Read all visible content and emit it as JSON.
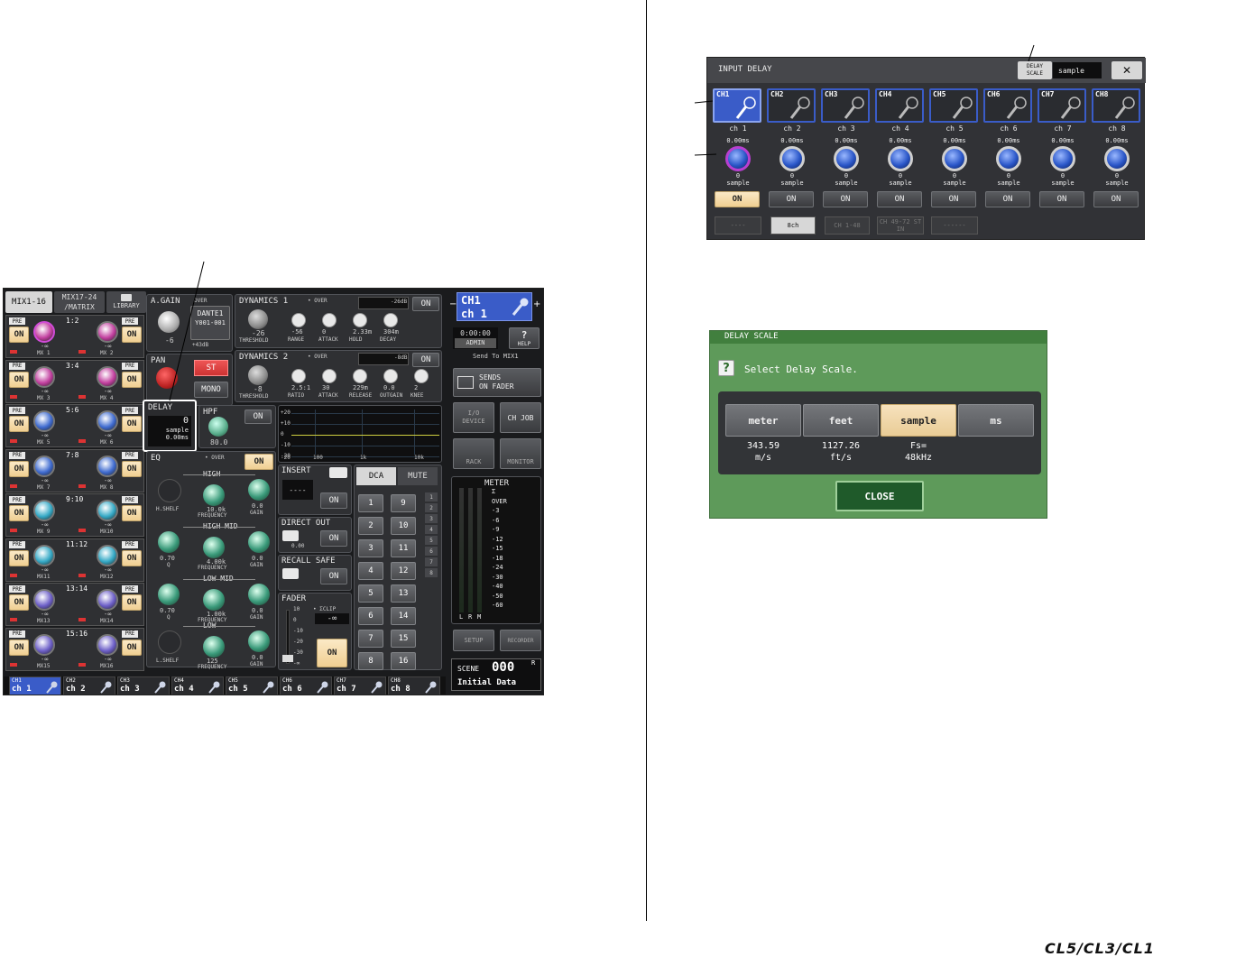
{
  "console": {
    "tabs": {
      "mix1_16": "MIX1-16",
      "mix17_24_l1": "MIX17-24",
      "mix17_24_l2": "/MATRIX",
      "library": "LIBRARY"
    },
    "mix_rows": [
      {
        "pair": "1:2",
        "left": "MX 1",
        "right": "MX 2"
      },
      {
        "pair": "3:4",
        "left": "MX 3",
        "right": "MX 4"
      },
      {
        "pair": "5:6",
        "left": "MX 5",
        "right": "MX 6"
      },
      {
        "pair": "7:8",
        "left": "MX 7",
        "right": "MX 8"
      },
      {
        "pair": "9:10",
        "left": "MX 9",
        "right": "MX10"
      },
      {
        "pair": "11:12",
        "left": "MX11",
        "right": "MX12"
      },
      {
        "pair": "13:14",
        "left": "MX13",
        "right": "MX14"
      },
      {
        "pair": "15:16",
        "left": "MX15",
        "right": "MX16"
      }
    ],
    "mix_on": "ON",
    "mix_pre": "PRE",
    "mix_level": "-∞",
    "again": {
      "label": "A.GAIN",
      "value": "-6"
    },
    "over": "OVER",
    "dante": {
      "name": "DANTE1",
      "port": "Y001-001",
      "gain": "+43dB"
    },
    "pan": {
      "label": "PAN",
      "st": "ST",
      "mono": "MONO"
    },
    "dyn1": {
      "label": "DYNAMICS 1",
      "over": "• OVER",
      "db": "-26dB",
      "on": "ON",
      "threshold": "-26",
      "range": "-56",
      "attack": "0",
      "hold": "2.33m",
      "decay": "304m",
      "threshold_l": "THRESHOLD",
      "range_l": "RANGE",
      "attack_l": "ATTACK",
      "hold_l": "HOLD",
      "decay_l": "DECAY"
    },
    "dyn2": {
      "label": "DYNAMICS 2",
      "over": "• OVER",
      "db": "-8dB",
      "on": "ON",
      "threshold": "-8",
      "ratio": "2.5:1",
      "attack": "30",
      "release": "229m",
      "outgain": "0.0",
      "knee": "2",
      "threshold_l": "THRESHOLD",
      "ratio_l": "RATIO",
      "attack_l": "ATTACK",
      "release_l": "RELEASE",
      "outgain_l": "OUTGAIN",
      "knee_l": "KNEE"
    },
    "delay": {
      "label": "DELAY",
      "value": "0",
      "unit": "sample",
      "ms": "0.00ms"
    },
    "hpf": {
      "label": "HPF",
      "on": "ON",
      "freq": "80.0"
    },
    "eq": {
      "label": "EQ",
      "over": "• OVER",
      "on": "ON",
      "high": "HIGH",
      "high_mid": "HIGH MID",
      "low_mid": "LOW MID",
      "low": "LOW",
      "h_shelf": "H.SHELF",
      "l_shelf": "L.SHELF",
      "high_freq": "10.0k",
      "high_gain": "0.0",
      "hmid_q": "0.70",
      "hmid_freq": "4.00k",
      "hmid_gain": "0.0",
      "lmid_q": "0.70",
      "lmid_freq": "1.00k",
      "lmid_gain": "0.0",
      "low_freq": "125",
      "low_gain": "0.0",
      "freq_l": "FREQUENCY",
      "gain_l": "GAIN",
      "q_l": "Q"
    },
    "graph": {
      "y": [
        "+20",
        "+10",
        "0",
        "-10",
        "-20"
      ],
      "x": [
        "-20",
        "100",
        "1k",
        "10k"
      ]
    },
    "insert": {
      "label": "INSERT",
      "value": "----",
      "on": "ON"
    },
    "direct_out": {
      "label": "DIRECT OUT",
      "value": "0.00",
      "on": "ON"
    },
    "recall_safe": {
      "label": "RECALL SAFE",
      "on": "ON"
    },
    "fader": {
      "label": "FADER",
      "clip": "• ΣCLIP",
      "value": "-∞",
      "on": "ON",
      "scale": [
        "10",
        "0",
        "-10",
        "-20",
        "-30",
        "-∞"
      ]
    },
    "dca": {
      "tab": "DCA",
      "mute": "MUTE",
      "buttons": [
        "1",
        "9",
        "2",
        "10",
        "3",
        "11",
        "4",
        "12",
        "5",
        "13",
        "6",
        "14",
        "7",
        "15",
        "8",
        "16"
      ],
      "side": [
        "1",
        "2",
        "3",
        "4",
        "5",
        "6",
        "7",
        "8"
      ]
    },
    "right": {
      "ch_id": "CH1",
      "ch_name": "ch 1",
      "time": "0:00:00",
      "user": "ADMIN",
      "help": "HELP",
      "send_to": "Send To MIX1",
      "sends_l1": "SENDS",
      "sends_l2": "ON FADER",
      "io_l1": "I/O",
      "io_l2": "DEVICE",
      "ch_job": "CH JOB",
      "rack": "RACK",
      "monitor": "MONITOR",
      "meter": "METER",
      "meter_scale": [
        "Σ",
        "OVER",
        "-3",
        "-6",
        "-9",
        "-12",
        "-15",
        "-18",
        "-24",
        "-30",
        "-40",
        "-50",
        "-60"
      ],
      "meter_lrm": [
        "L",
        "R",
        "M"
      ],
      "setup": "SETUP",
      "recorder": "RECORDER",
      "scene_label": "SCENE",
      "scene_num": "000",
      "scene_r": "R",
      "scene_name": "Initial Data"
    },
    "bottom_channels": [
      {
        "id": "CH1",
        "name": "ch 1"
      },
      {
        "id": "CH2",
        "name": "ch 2"
      },
      {
        "id": "CH3",
        "name": "ch 3"
      },
      {
        "id": "CH4",
        "name": "ch 4"
      },
      {
        "id": "CH5",
        "name": "ch 5"
      },
      {
        "id": "CH6",
        "name": "ch 6"
      },
      {
        "id": "CH7",
        "name": "ch 7"
      },
      {
        "id": "CH8",
        "name": "ch 8"
      }
    ]
  },
  "input_delay": {
    "title": "INPUT DELAY",
    "scale_l1": "DELAY",
    "scale_l2": "SCALE",
    "scale_value": "sample",
    "close": "✕",
    "channels": [
      {
        "id": "CH1",
        "name": "ch 1",
        "ms": "0.00ms",
        "value": "0",
        "unit": "sample",
        "on": "ON"
      },
      {
        "id": "CH2",
        "name": "ch 2",
        "ms": "0.00ms",
        "value": "0",
        "unit": "sample",
        "on": "ON"
      },
      {
        "id": "CH3",
        "name": "ch 3",
        "ms": "0.00ms",
        "value": "0",
        "unit": "sample",
        "on": "ON"
      },
      {
        "id": "CH4",
        "name": "ch 4",
        "ms": "0.00ms",
        "value": "0",
        "unit": "sample",
        "on": "ON"
      },
      {
        "id": "CH5",
        "name": "ch 5",
        "ms": "0.00ms",
        "value": "0",
        "unit": "sample",
        "on": "ON"
      },
      {
        "id": "CH6",
        "name": "ch 6",
        "ms": "0.00ms",
        "value": "0",
        "unit": "sample",
        "on": "ON"
      },
      {
        "id": "CH7",
        "name": "ch 7",
        "ms": "0.00ms",
        "value": "0",
        "unit": "sample",
        "on": "ON"
      },
      {
        "id": "CH8",
        "name": "ch 8",
        "ms": "0.00ms",
        "value": "0",
        "unit": "sample",
        "on": "ON"
      }
    ],
    "tabs": [
      "----",
      "8ch",
      "CH 1-48",
      "CH 49-72 ST IN",
      "------"
    ]
  },
  "delay_scale": {
    "title": "DELAY SCALE",
    "prompt": "Select Delay Scale.",
    "options": [
      {
        "label": "meter",
        "info1": "343.59",
        "info2": "m/s"
      },
      {
        "label": "feet",
        "info1": "1127.26",
        "info2": "ft/s"
      },
      {
        "label": "sample",
        "info1": "Fs=",
        "info2": "48kHz"
      },
      {
        "label": "ms",
        "info1": "",
        "info2": ""
      }
    ],
    "close": "CLOSE"
  },
  "footer": {
    "logo": "CL5/CL3/CL1"
  },
  "colors": {
    "accent_blue": "#3a5cc8",
    "on_yellow": "#f0cf92",
    "dialog_green": "#5e9a5a",
    "close_green": "#1f5a2a",
    "st_red": "#d9444c"
  }
}
